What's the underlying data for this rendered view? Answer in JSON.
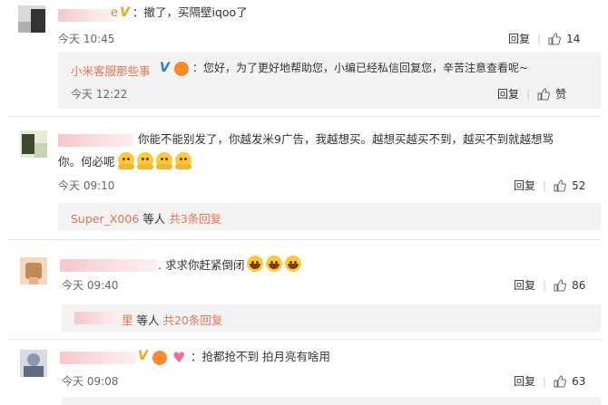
{
  "c1": {
    "name_suffix": "e",
    "text": "：撤了，买隔壁iqoo了",
    "time": "今天 10:45",
    "reply": "回复",
    "likes": "14",
    "sub": {
      "name": "小米客服那些事",
      "text": "：您好，为了更好地帮助您，小编已经私信回复您，辛苦注意查看呢~",
      "time": "今天 12:22",
      "reply": "回复",
      "likes": "赞"
    }
  },
  "c2": {
    "text_line1": "你能不能别发了，你越发米9广告，我越想买。越想买越买不到，越买不到就越想骂",
    "text_line2": "你。何必呢",
    "time": "今天 09:10",
    "reply": "回复",
    "likes": "52",
    "more_name": "Super_X006",
    "more_mid": " 等人 ",
    "more_count": "共3条回复"
  },
  "c3": {
    "text": ". 求求你赶紧倒闭",
    "time": "今天 09:40",
    "reply": "回复",
    "likes": "86",
    "more_name_suffix": "里",
    "more_mid": " 等人 ",
    "more_count": "共20条回复"
  },
  "c4": {
    "text": "：抢都抢不到 拍月亮有啥用",
    "time": "今天 09:08",
    "reply": "回复",
    "likes": "63"
  },
  "icons": {
    "like": "thumbs-up-icon",
    "verified": "verified-v-icon"
  }
}
